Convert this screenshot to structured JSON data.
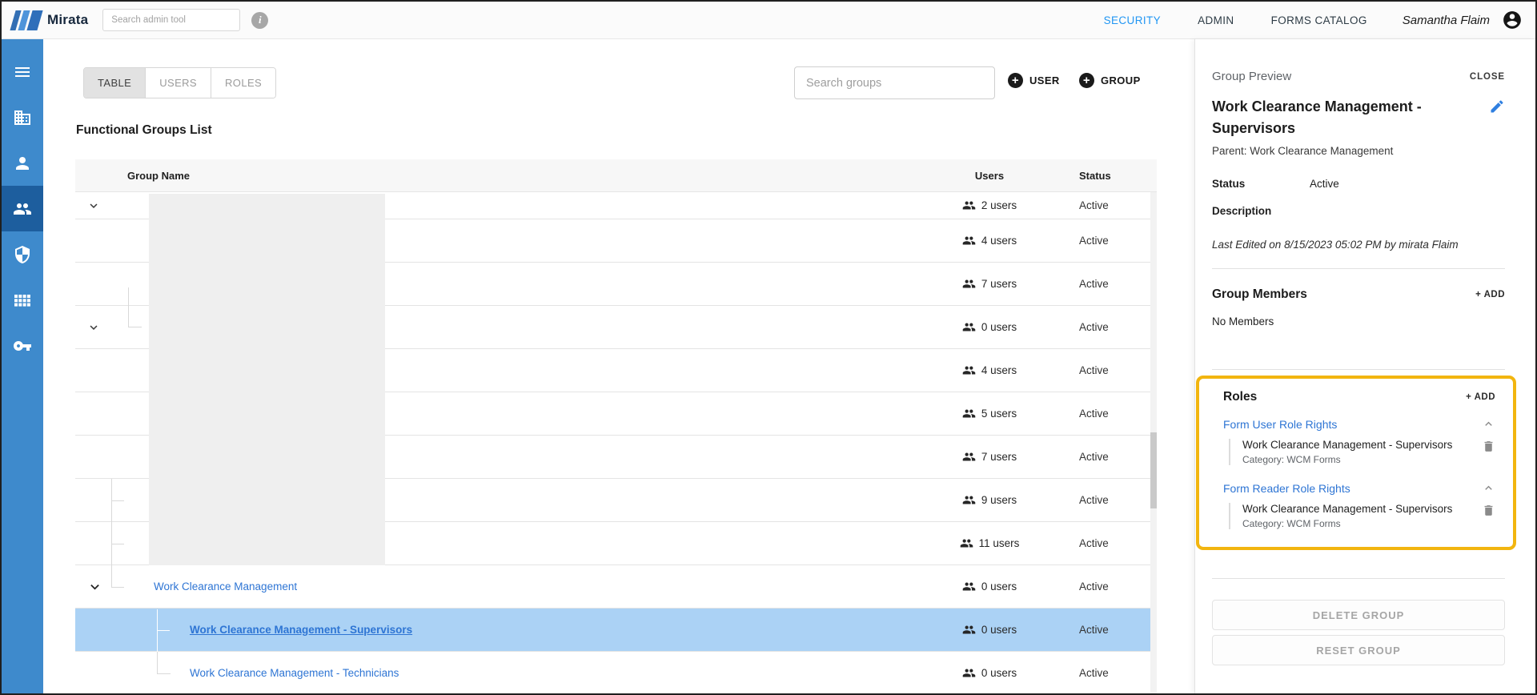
{
  "colors": {
    "brand_blue": "#3E8ACC",
    "sidebar_active_blue": "#1D5E9E",
    "nav_active_blue": "#2196F3",
    "link_blue": "#2E75D4",
    "selected_row_blue": "#ABD2F5",
    "highlight_yellow": "#F2B50F"
  },
  "topbar": {
    "brand": "Mirata",
    "search_placeholder": "Search admin tool",
    "nav": [
      {
        "label": "SECURITY"
      },
      {
        "label": "ADMIN"
      },
      {
        "label": "FORMS CATALOG"
      }
    ],
    "user_name": "Samantha Flaim"
  },
  "sidebar": {
    "items": [
      {
        "icon": "menu-icon"
      },
      {
        "icon": "organization-icon"
      },
      {
        "icon": "user-icon"
      },
      {
        "icon": "groups-icon",
        "active": true
      },
      {
        "icon": "shield-icon"
      },
      {
        "icon": "grid-icon"
      },
      {
        "icon": "key-icon"
      }
    ]
  },
  "toolbar": {
    "tabs": [
      {
        "label": "TABLE",
        "active": true
      },
      {
        "label": "USERS"
      },
      {
        "label": "ROLES"
      }
    ],
    "search_placeholder": "Search groups",
    "add_user": "USER",
    "add_group": "GROUP"
  },
  "table": {
    "title": "Functional Groups List",
    "columns": {
      "name": "Group Name",
      "users": "Users",
      "status": "Status"
    },
    "rows": [
      {
        "name": "",
        "users": "2 users",
        "status": "Active"
      },
      {
        "name": "",
        "users": "4 users",
        "status": "Active"
      },
      {
        "name": "",
        "users": "7 users",
        "status": "Active"
      },
      {
        "name": "",
        "users": "0 users",
        "status": "Active"
      },
      {
        "name": "",
        "users": "4 users",
        "status": "Active"
      },
      {
        "name": "",
        "users": "5 users",
        "status": "Active"
      },
      {
        "name": "",
        "users": "7 users",
        "status": "Active"
      },
      {
        "name": "",
        "users": "9 users",
        "status": "Active"
      },
      {
        "name": "",
        "users": "11 users",
        "status": "Active"
      },
      {
        "name": "Work Clearance Management",
        "users": "0 users",
        "status": "Active"
      },
      {
        "name": "Work Clearance Management - Supervisors",
        "users": "0 users",
        "status": "Active",
        "selected": true
      },
      {
        "name": "Work Clearance Management - Technicians",
        "users": "0 users",
        "status": "Active"
      }
    ]
  },
  "preview": {
    "header": "Group Preview",
    "close": "CLOSE",
    "title": "Work Clearance Management - Supervisors",
    "parent": "Parent: Work Clearance Management",
    "status_label": "Status",
    "status_value": "Active",
    "description_label": "Description",
    "last_edited": "Last Edited on 8/15/2023 05:02 PM by mirata Flaim",
    "members": {
      "title": "Group Members",
      "add": "+ ADD",
      "empty": "No Members"
    },
    "roles": {
      "title": "Roles",
      "add": "+ ADD",
      "groups": [
        {
          "label": "Form User Role Rights",
          "item": {
            "name": "Work Clearance Management - Supervisors",
            "category": "Category: WCM Forms"
          }
        },
        {
          "label": "Form Reader Role Rights",
          "item": {
            "name": "Work Clearance Management - Supervisors",
            "category": "Category: WCM Forms"
          }
        }
      ]
    },
    "delete_button": "DELETE GROUP",
    "reset_button": "RESET GROUP"
  }
}
